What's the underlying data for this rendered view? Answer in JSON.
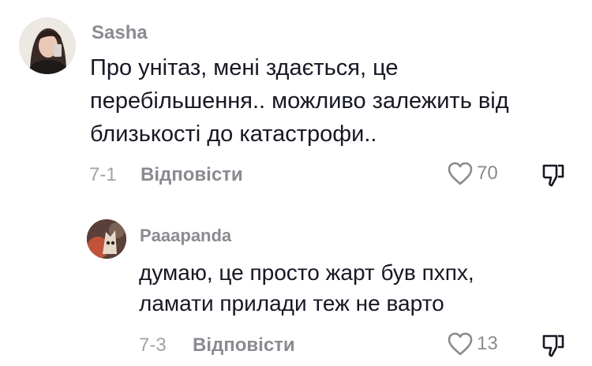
{
  "comments": [
    {
      "author": "Sasha",
      "text_lines": [
        "Про унітаз, мені здається, це",
        "перебільшення.. можливо залежить від",
        "близькості до катастрофи.."
      ],
      "date": "7-1",
      "reply_label": "Відповісти",
      "likes": "70",
      "avatar_icon": "user-photo-avatar",
      "replies": [
        {
          "author": "Paaapanda",
          "text_lines": [
            "думаю, це просто жарт був пхпх,",
            "ламати прилади теж не варто"
          ],
          "date": "7-3",
          "reply_label": "Відповісти",
          "likes": "13",
          "avatar_icon": "cat-photo-avatar"
        }
      ]
    }
  ],
  "colors": {
    "text": "#161823",
    "meta": "#8a8b91",
    "date": "#a1a2a7"
  }
}
